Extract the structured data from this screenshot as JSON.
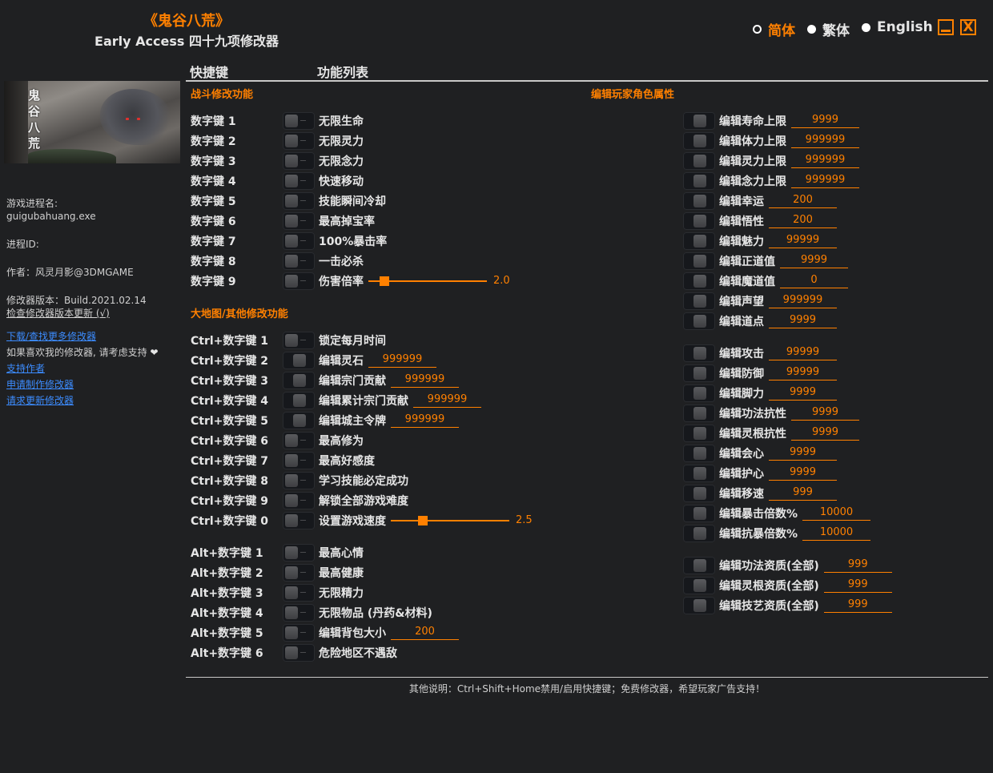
{
  "header": {
    "game_title": "《鬼谷八荒》",
    "subtitle": "Early Access 四十九项修改器"
  },
  "languages": [
    {
      "label": "简体",
      "selected": true
    },
    {
      "label": "繁体",
      "selected": false
    },
    {
      "label": "English",
      "selected": false
    }
  ],
  "window_controls": {
    "minimize_icon": "minimize-icon",
    "close_label": "X"
  },
  "sidebar": {
    "process_label": "游戏进程名:",
    "process_name": "guigubahuang.exe",
    "pid_label": "进程ID:",
    "author": "作者：风灵月影@3DMGAME",
    "version": "修改器版本：Build.2021.02.14",
    "check_update": "检查修改器版本更新 (√)",
    "links": {
      "download_more": "下载/查找更多修改器",
      "support_text": "如果喜欢我的修改器, 请考虑支持",
      "heart": "❤",
      "support_author": "支持作者",
      "request_trainer": "申请制作修改器",
      "request_update": "请求更新修改器"
    }
  },
  "columns": {
    "hotkey": "快捷键",
    "features": "功能列表"
  },
  "sections": {
    "combat": "战斗修改功能",
    "map": "大地图/其他修改功能",
    "player": "编辑玩家角色属性"
  },
  "combat": [
    {
      "hotkey": "数字键 1",
      "label": "无限生命",
      "on": false
    },
    {
      "hotkey": "数字键 2",
      "label": "无限灵力",
      "on": false
    },
    {
      "hotkey": "数字键 3",
      "label": "无限念力",
      "on": false
    },
    {
      "hotkey": "数字键 4",
      "label": "快速移动",
      "on": false
    },
    {
      "hotkey": "数字键 5",
      "label": "技能瞬间冷却",
      "on": false
    },
    {
      "hotkey": "数字键 6",
      "label": "最高掉宝率",
      "on": false
    },
    {
      "hotkey": "数字键 7",
      "label": "100%暴击率",
      "on": false
    },
    {
      "hotkey": "数字键 8",
      "label": "一击必杀",
      "on": false
    },
    {
      "hotkey": "数字键 9",
      "label": "伤害倍率",
      "on": false,
      "slider": "2.0",
      "slider_fraction": 0.1
    }
  ],
  "map": [
    {
      "hotkey": "Ctrl+数字键 1",
      "label": "锁定每月时间",
      "on": false
    },
    {
      "hotkey": "Ctrl+数字键 2",
      "label": "编辑灵石",
      "on": true,
      "value": "999999"
    },
    {
      "hotkey": "Ctrl+数字键 3",
      "label": "编辑宗门贡献",
      "on": true,
      "value": "999999"
    },
    {
      "hotkey": "Ctrl+数字键 4",
      "label": "编辑累计宗门贡献",
      "on": true,
      "value": "999999"
    },
    {
      "hotkey": "Ctrl+数字键 5",
      "label": "编辑城主令牌",
      "on": true,
      "value": "999999"
    },
    {
      "hotkey": "Ctrl+数字键 6",
      "label": "最高修为",
      "on": false
    },
    {
      "hotkey": "Ctrl+数字键 7",
      "label": "最高好感度",
      "on": false
    },
    {
      "hotkey": "Ctrl+数字键 8",
      "label": "学习技能必定成功",
      "on": false
    },
    {
      "hotkey": "Ctrl+数字键 9",
      "label": "解锁全部游戏难度",
      "on": false
    },
    {
      "hotkey": "Ctrl+数字键 0",
      "label": "设置游戏速度",
      "on": false,
      "slider": "2.5",
      "slider_fraction": 0.25
    }
  ],
  "alt": [
    {
      "hotkey": "Alt+数字键 1",
      "label": "最高心情",
      "on": false
    },
    {
      "hotkey": "Alt+数字键 2",
      "label": "最高健康",
      "on": false
    },
    {
      "hotkey": "Alt+数字键 3",
      "label": "无限精力",
      "on": false
    },
    {
      "hotkey": "Alt+数字键 4",
      "label": "无限物品 (丹药&材料)",
      "on": false
    },
    {
      "hotkey": "Alt+数字键 5",
      "label": "编辑背包大小",
      "on": false,
      "value": "200"
    },
    {
      "hotkey": "Alt+数字键 6",
      "label": "危险地区不遇敌",
      "on": false
    }
  ],
  "player_group1": [
    {
      "label": "编辑寿命上限",
      "on": true,
      "value": "9999"
    },
    {
      "label": "编辑体力上限",
      "on": true,
      "value": "999999"
    },
    {
      "label": "编辑灵力上限",
      "on": true,
      "value": "999999"
    },
    {
      "label": "编辑念力上限",
      "on": true,
      "value": "999999"
    },
    {
      "label": "编辑幸运",
      "on": true,
      "value": "200"
    },
    {
      "label": "编辑悟性",
      "on": true,
      "value": "200"
    },
    {
      "label": "编辑魅力",
      "on": true,
      "value": "99999"
    },
    {
      "label": "编辑正道值",
      "on": true,
      "value": "9999"
    },
    {
      "label": "编辑魔道值",
      "on": true,
      "value": "0"
    },
    {
      "label": "编辑声望",
      "on": true,
      "value": "999999"
    },
    {
      "label": "编辑道点",
      "on": true,
      "value": "9999"
    }
  ],
  "player_group2": [
    {
      "label": "编辑攻击",
      "on": true,
      "value": "99999"
    },
    {
      "label": "编辑防御",
      "on": true,
      "value": "99999"
    },
    {
      "label": "编辑脚力",
      "on": true,
      "value": "9999"
    },
    {
      "label": "编辑功法抗性",
      "on": true,
      "value": "9999"
    },
    {
      "label": "编辑灵根抗性",
      "on": true,
      "value": "9999"
    },
    {
      "label": "编辑会心",
      "on": true,
      "value": "9999"
    },
    {
      "label": "编辑护心",
      "on": true,
      "value": "9999"
    },
    {
      "label": "编辑移速",
      "on": true,
      "value": "999"
    },
    {
      "label": "编辑暴击倍数%",
      "on": true,
      "value": "10000"
    },
    {
      "label": "编辑抗暴倍数%",
      "on": true,
      "value": "10000"
    }
  ],
  "player_group3": [
    {
      "label": "编辑功法资质(全部)",
      "on": true,
      "value": "999"
    },
    {
      "label": "编辑灵根资质(全部)",
      "on": true,
      "value": "999"
    },
    {
      "label": "编辑技艺资质(全部)",
      "on": true,
      "value": "999"
    }
  ],
  "footer": "其他说明：Ctrl+Shift+Home禁用/启用快捷键；免费修改器，希望玩家广告支持！",
  "colors": {
    "accent": "#ff8000",
    "background": "#1f2022",
    "link": "#3c8cff"
  }
}
